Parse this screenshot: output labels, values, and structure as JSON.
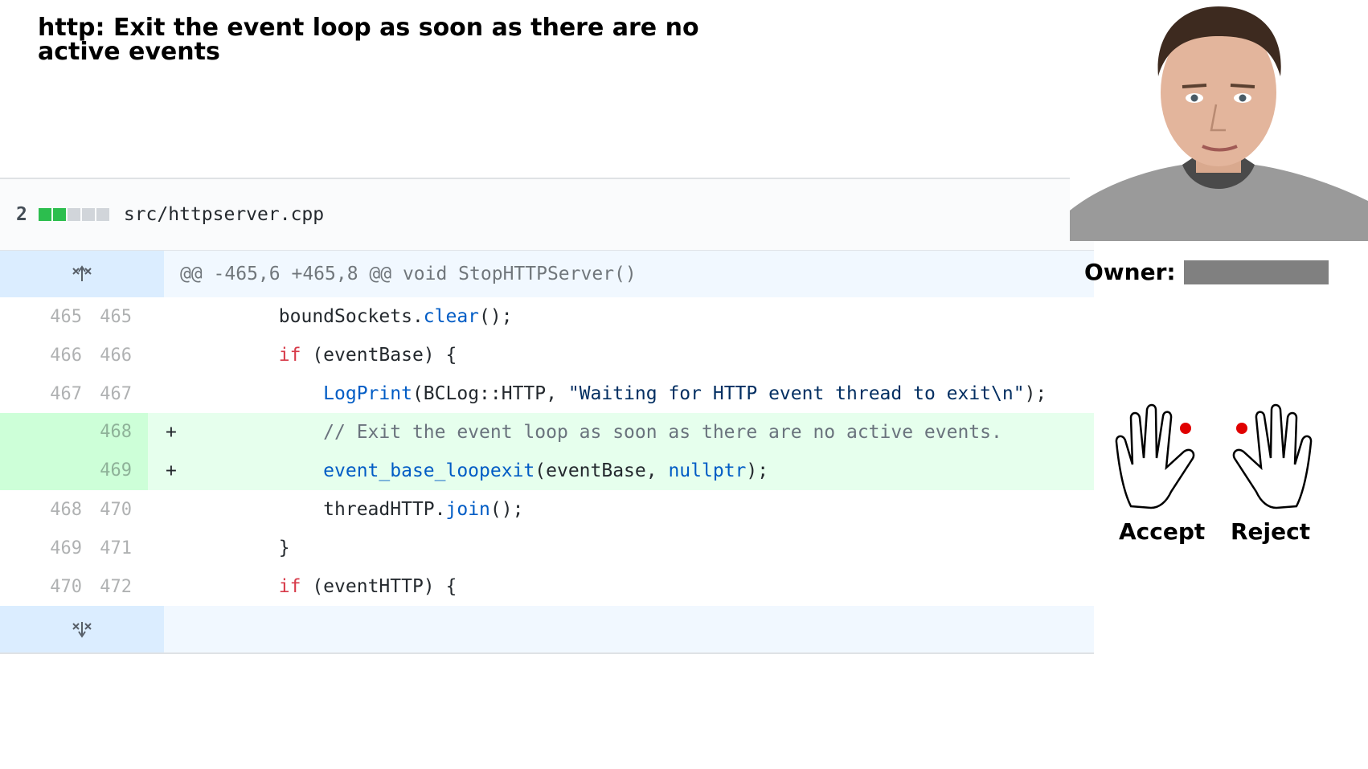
{
  "title": "http: Exit the event loop as soon as there are no active events",
  "file": {
    "changes": "2",
    "path": "src/httpserver.cpp",
    "stat_added": 2,
    "stat_total": 5,
    "colors": {
      "added": "#2cbe4e",
      "neutral": "#d1d5da"
    }
  },
  "hunk_header": "@@ -465,6 +465,8 @@ void StopHTTPServer()",
  "lines": [
    {
      "old": "465",
      "new": "465",
      "marker": "",
      "type": "context",
      "indent": "        ",
      "tokens": [
        {
          "t": "boundSockets.",
          "c": ""
        },
        {
          "t": "clear",
          "c": "fn"
        },
        {
          "t": "();",
          "c": ""
        }
      ]
    },
    {
      "old": "466",
      "new": "466",
      "marker": "",
      "type": "context",
      "indent": "        ",
      "tokens": [
        {
          "t": "if",
          "c": "kw"
        },
        {
          "t": " (eventBase) {",
          "c": ""
        }
      ]
    },
    {
      "old": "467",
      "new": "467",
      "marker": "",
      "type": "context",
      "indent": "            ",
      "tokens": [
        {
          "t": "LogPrint",
          "c": "fn"
        },
        {
          "t": "(BCLog::HTTP, ",
          "c": ""
        },
        {
          "t": "\"Waiting for HTTP event thread to exit\\n\"",
          "c": "str"
        },
        {
          "t": ");",
          "c": ""
        }
      ]
    },
    {
      "old": "",
      "new": "468",
      "marker": "+",
      "type": "added",
      "indent": "            ",
      "tokens": [
        {
          "t": "// Exit the event loop as soon as there are no active events.",
          "c": "cm"
        }
      ]
    },
    {
      "old": "",
      "new": "469",
      "marker": "+",
      "type": "added",
      "indent": "            ",
      "tokens": [
        {
          "t": "event_base_loopexit",
          "c": "fn"
        },
        {
          "t": "(eventBase, ",
          "c": ""
        },
        {
          "t": "nullptr",
          "c": "fn"
        },
        {
          "t": ");",
          "c": ""
        }
      ]
    },
    {
      "old": "468",
      "new": "470",
      "marker": "",
      "type": "context",
      "indent": "            ",
      "tokens": [
        {
          "t": "threadHTTP.",
          "c": ""
        },
        {
          "t": "join",
          "c": "fn"
        },
        {
          "t": "();",
          "c": ""
        }
      ]
    },
    {
      "old": "469",
      "new": "471",
      "marker": "",
      "type": "context",
      "indent": "        ",
      "tokens": [
        {
          "t": "}",
          "c": ""
        }
      ]
    },
    {
      "old": "470",
      "new": "472",
      "marker": "",
      "type": "context",
      "indent": "        ",
      "tokens": [
        {
          "t": "if",
          "c": "kw"
        },
        {
          "t": " (eventHTTP) {",
          "c": ""
        }
      ]
    }
  ],
  "owner_label": "Owner:",
  "accept_label": "Accept",
  "reject_label": "Reject",
  "icons": {
    "expand_up": "expand-up-icon",
    "expand_down": "expand-down-icon",
    "accept": "left-hand-icon",
    "reject": "right-hand-icon"
  }
}
